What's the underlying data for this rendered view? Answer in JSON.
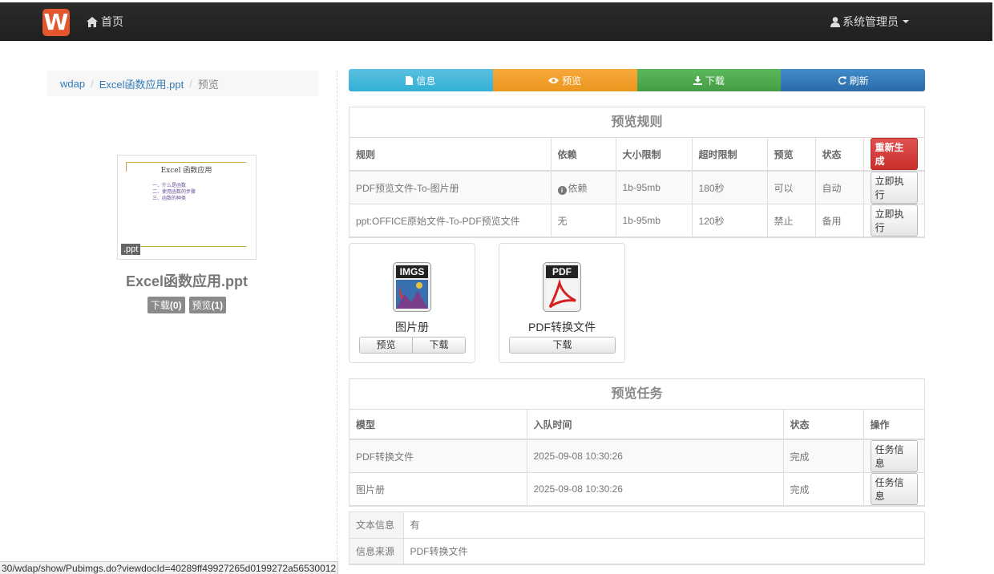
{
  "navbar": {
    "brand_letter": "W",
    "home_label": "首页",
    "user_label": "系统管理员"
  },
  "breadcrumb": {
    "items": [
      "wdap",
      "Excel函数应用.ppt"
    ],
    "active": "预览"
  },
  "document": {
    "thumb_title": "Excel 函数应用",
    "thumb_items": [
      "一、什么是函数",
      "二、使用函数的步骤",
      "三、函数的种类"
    ],
    "ext_tag": ".ppt",
    "filename": "Excel函数应用.ppt",
    "download_badge_label": "下载",
    "download_count": "(0)",
    "preview_badge_label": "预览",
    "preview_count": "(1)"
  },
  "toolbar": {
    "info": "信息",
    "preview": "预览",
    "download": "下载",
    "refresh": "刷新"
  },
  "rules": {
    "title": "预览规则",
    "headers": [
      "规则",
      "依赖",
      "大小限制",
      "超时限制",
      "预览",
      "状态"
    ],
    "regen_label": "重新生成",
    "rows": [
      {
        "rule": "PDF预览文件-To-图片册",
        "dep": "依赖",
        "size": "1b-95mb",
        "timeout": "180秒",
        "preview": "可以",
        "status": "自动",
        "action": "立即执行"
      },
      {
        "rule": "ppt:OFFICE原始文件-To-PDF预览文件",
        "dep": "无",
        "size": "1b-95mb",
        "timeout": "120秒",
        "preview": "禁止",
        "status": "备用",
        "action": "立即执行"
      }
    ]
  },
  "formats": [
    {
      "icon_label": "IMGS",
      "name": "图片册",
      "btn1": "预览",
      "btn2": "下载"
    },
    {
      "icon_label": "PDF",
      "name": "PDF转换文件",
      "btn1": "下载"
    }
  ],
  "tasks": {
    "title": "预览任务",
    "headers": [
      "模型",
      "入队时间",
      "状态",
      "操作"
    ],
    "rows": [
      {
        "model": "PDF转换文件",
        "time": "2025-09-08 10:30:26",
        "status": "完成",
        "action": "任务信息"
      },
      {
        "model": "图片册",
        "time": "2025-09-08 10:30:26",
        "status": "完成",
        "action": "任务信息"
      }
    ]
  },
  "info": {
    "rows": [
      {
        "key": "文本信息",
        "value": "有"
      },
      {
        "key": "信息来源",
        "value": "PDF转换文件"
      }
    ]
  },
  "statusbar": {
    "url": "30/wdap/show/Pubimgs.do?viewdocId=40289ff49927265d0199272a56530012"
  },
  "colors": {
    "info": "#5bc0de",
    "preview": "#f0ad4e",
    "download": "#5cb85c",
    "refresh": "#428bca",
    "danger": "#d9534f",
    "brand": "#e4572e"
  }
}
